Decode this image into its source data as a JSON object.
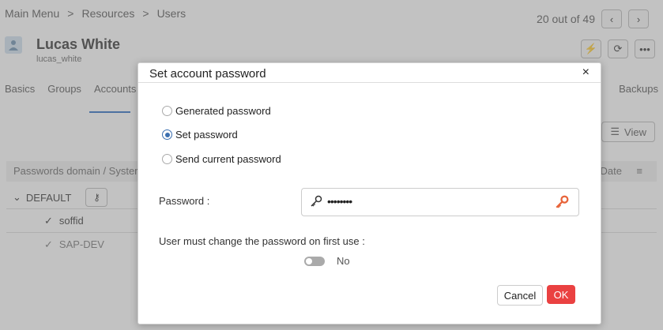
{
  "breadcrumb": {
    "items": [
      "Main Menu",
      ">",
      "Resources",
      ">",
      "Users"
    ]
  },
  "pager": {
    "text": "20 out of 49",
    "prev_icon": "chevron-left",
    "next_icon": "chevron-right"
  },
  "user": {
    "name": "Lucas White",
    "login": "lucas_white"
  },
  "header_actions": [
    "lightning-icon",
    "refresh-icon",
    "more-icon"
  ],
  "tabs": {
    "items": [
      "Basics",
      "Groups",
      "Accounts"
    ],
    "right": "Backups",
    "active": "Accounts"
  },
  "view_button": {
    "label": "View"
  },
  "table": {
    "col1": "Passwords domain / Syster",
    "col2": "Date",
    "group": "DEFAULT",
    "rows": [
      "soffid",
      "SAP-DEV"
    ]
  },
  "dialog": {
    "title": "Set account password",
    "close": "×",
    "options": [
      {
        "label": "Generated password",
        "selected": false
      },
      {
        "label": "Set password",
        "selected": true
      },
      {
        "label": "Send current password",
        "selected": false
      }
    ],
    "password_label": "Password :",
    "password_value": "••••••••",
    "must_change_label": "User must change the password on first use :",
    "toggle_value": "No",
    "cancel": "Cancel",
    "ok": "OK"
  },
  "colors": {
    "accent": "#2a6cc4",
    "ok": "#ea4141",
    "key_orange": "#e8643a"
  }
}
